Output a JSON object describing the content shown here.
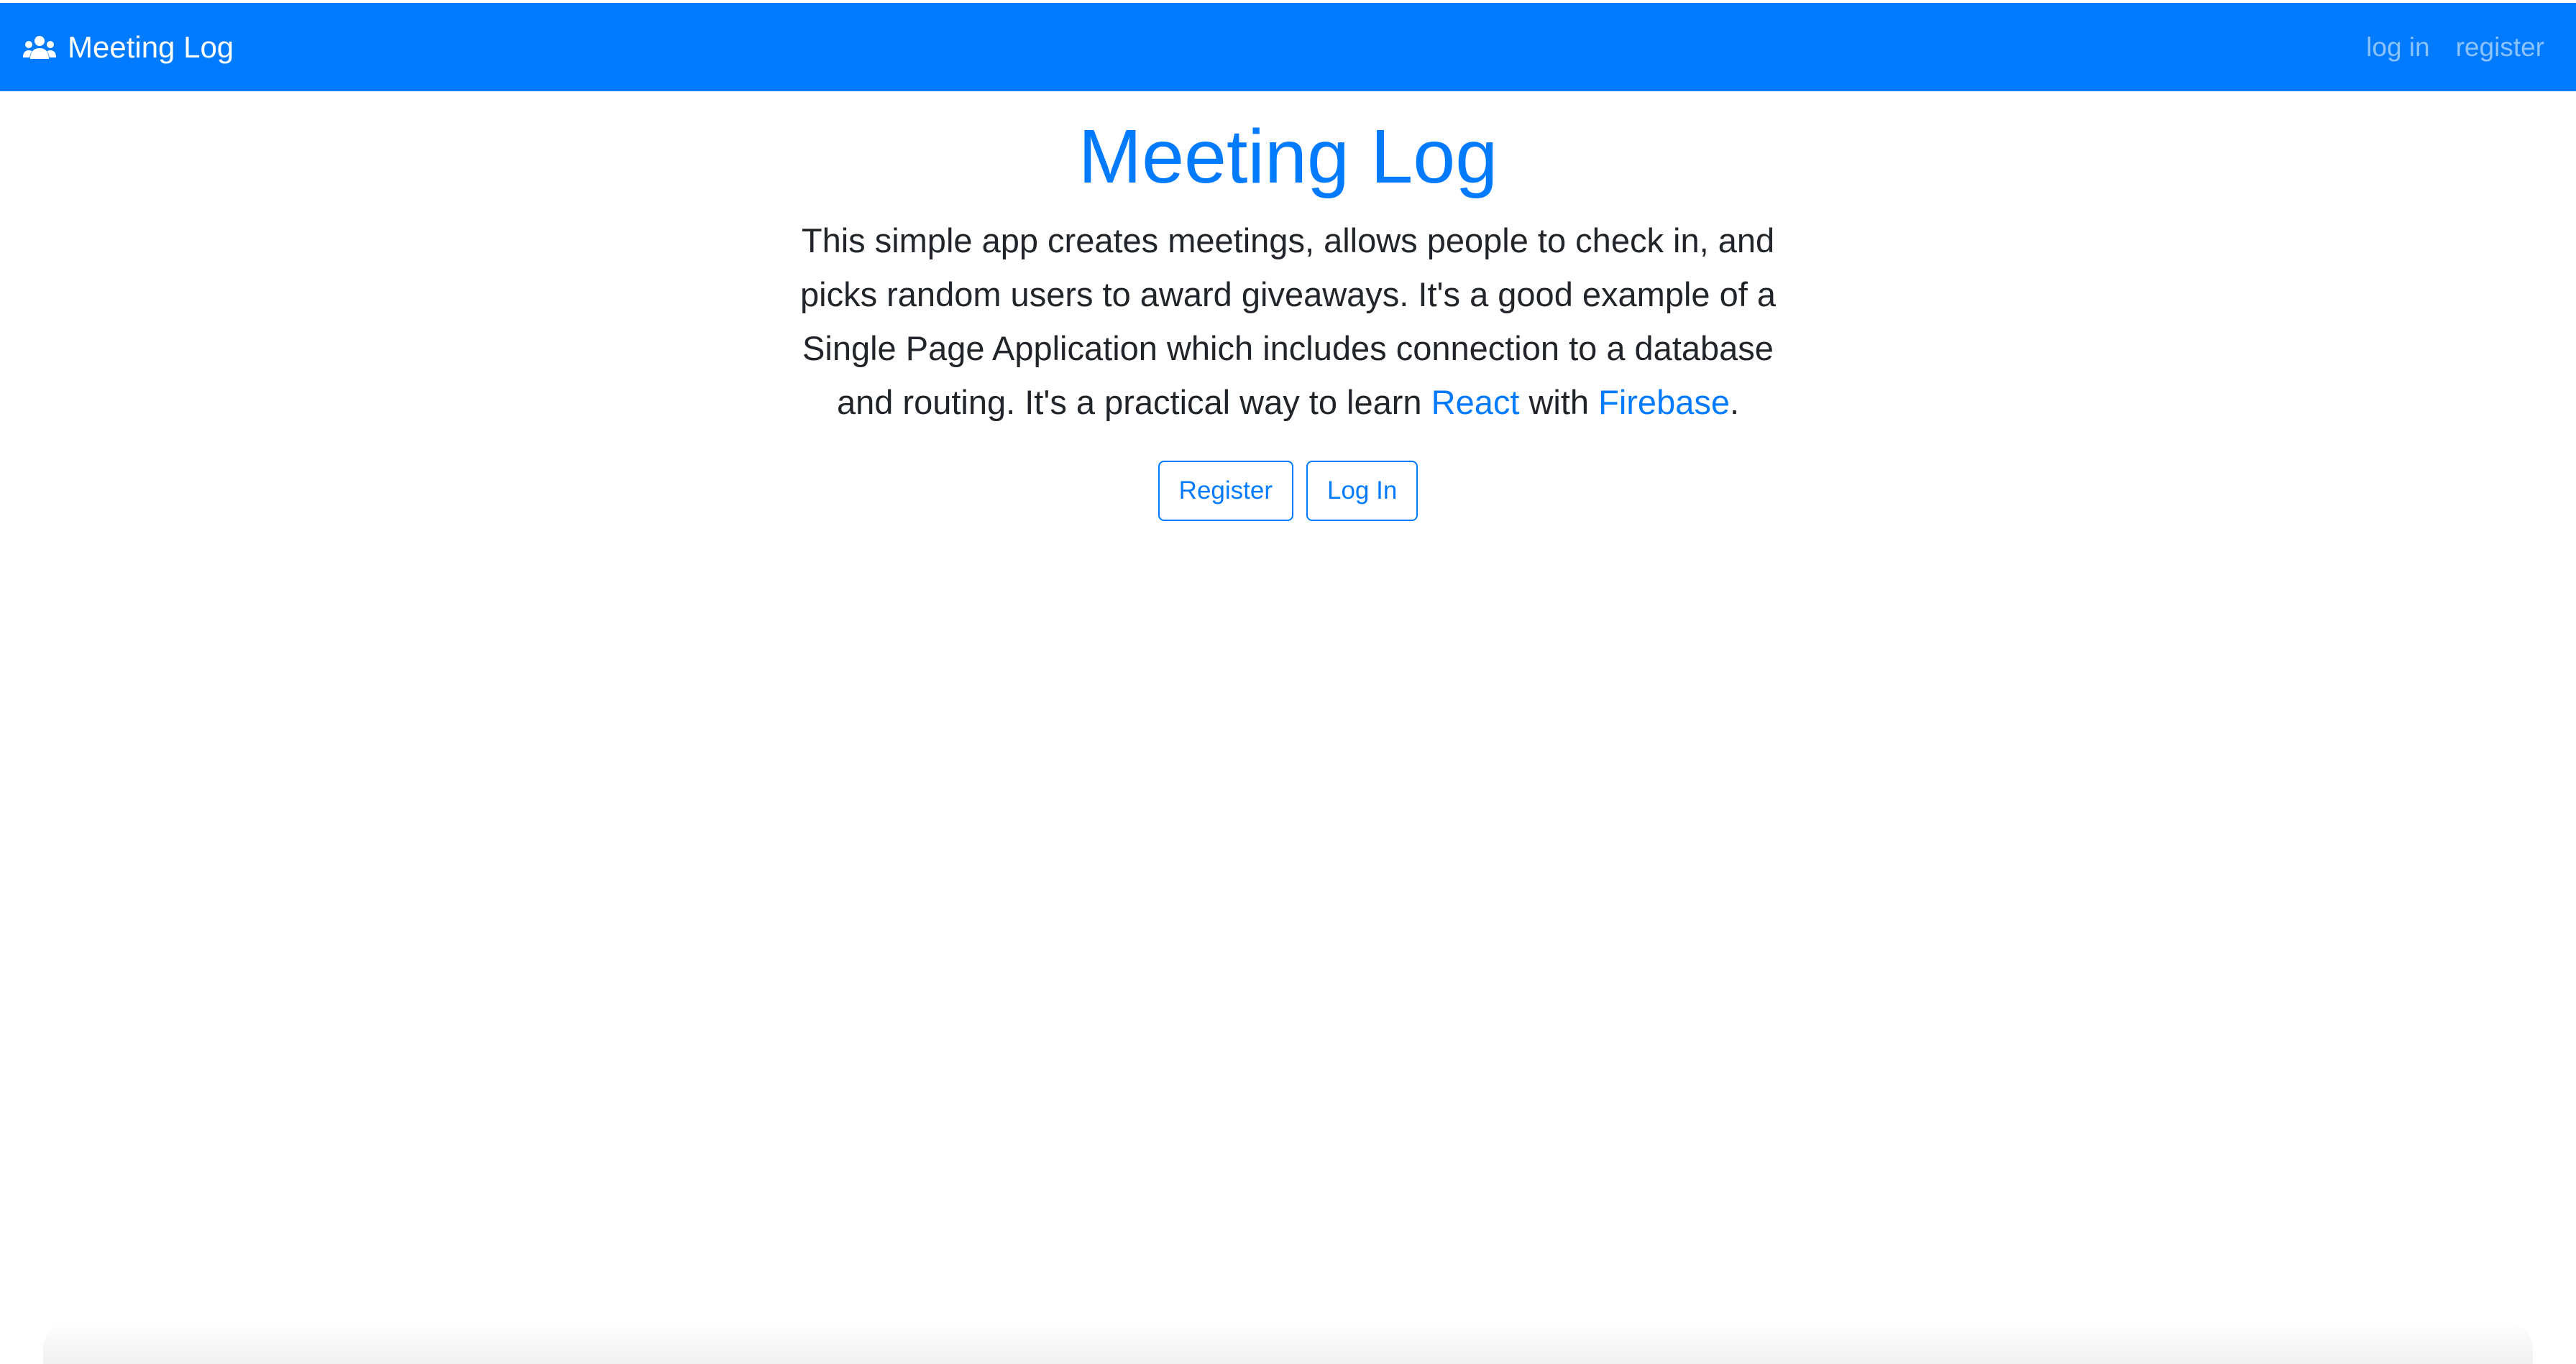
{
  "navbar": {
    "brand_label": "Meeting Log",
    "brand_icon": "users-icon",
    "links": [
      {
        "label": "log in"
      },
      {
        "label": "register"
      }
    ]
  },
  "hero": {
    "title": "Meeting Log",
    "text_intro": "This simple app creates meetings, allows people to check in, and picks random users to award giveaways. It's a good example of a Single Page Application which includes connection to a database and routing. It's a practical way to learn ",
    "link_react": "React",
    "text_with": " with ",
    "link_firebase": "Firebase",
    "text_end": ".",
    "buttons": {
      "register": "Register",
      "login": "Log In"
    }
  },
  "colors": {
    "primary": "#007bff",
    "navbar_link": "rgba(255,255,255,0.55)",
    "text": "#212529",
    "background": "#ffffff"
  }
}
